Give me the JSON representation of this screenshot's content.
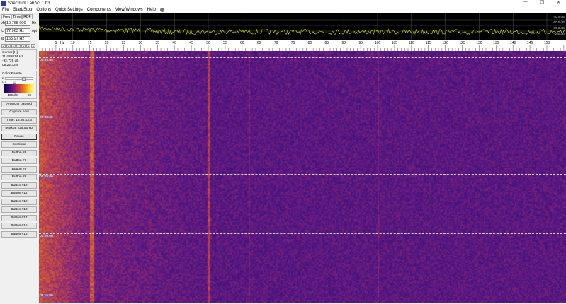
{
  "window": {
    "title": "Spectrum Lab V3.1 b3",
    "controls": [
      "—",
      "❐",
      "✕"
    ]
  },
  "menu": [
    "File",
    "Start/Stop",
    "Options",
    "Quick Settings",
    "Components",
    "View/Windows",
    "Help"
  ],
  "tabs": [
    "Freq",
    "Time",
    "RDF"
  ],
  "fields": {
    "vfo": {
      "label": "vfo",
      "value": "10 768 000",
      "unit": "Hz"
    },
    "fc": {
      "label": "fc",
      "value": "77.963 Hz",
      "unit": "opt"
    },
    "sp": {
      "label": "sp",
      "value": "155.97 Hz"
    }
  },
  "small_buttons": [
    "<",
    "<",
    "<",
    "-",
    "+",
    ">",
    ">"
  ],
  "cursor": {
    "title": "Cursor [H]",
    "freq": "11.439814 Hz",
    "level": "-92.735 dB",
    "time": "05:22:33.4"
  },
  "palette": {
    "title": "Color Palette",
    "b_label": "B",
    "c_label": "C",
    "b_value": 0.7,
    "c_value": 0.3,
    "min": "-100 dB",
    "max": "-50"
  },
  "buttons": [
    "Analyzer paused",
    "Capture now",
    "Time: 18:36:43.3",
    "peak at 228.50 Hz",
    "Pause",
    "Continue",
    "Button #6",
    "Button #7",
    "Button #8",
    "Button #9",
    "Button #10",
    "Button #11",
    "Button #12",
    "Button #13",
    "Button #14",
    "Button #15",
    "Button #16"
  ],
  "spectrum": {
    "db_labels": [
      "-40.0 dB",
      "-60.0 dB",
      "-80.0 dB",
      "-100 dB"
    ],
    "trace_color": "#c8c800"
  },
  "freq_axis": {
    "unit_label": "Hz",
    "ticks": [
      5,
      10,
      15,
      20,
      25,
      30,
      35,
      40,
      45,
      50,
      55,
      60,
      65,
      70,
      75,
      80,
      85,
      90,
      95,
      100,
      105,
      110,
      115,
      120,
      125,
      130,
      135,
      140,
      145,
      150
    ]
  },
  "waterfall": {
    "time_labels": [
      "05:35:00",
      "05:30:00",
      "05:25:00",
      "05:20:00",
      "05:15:00"
    ]
  }
}
